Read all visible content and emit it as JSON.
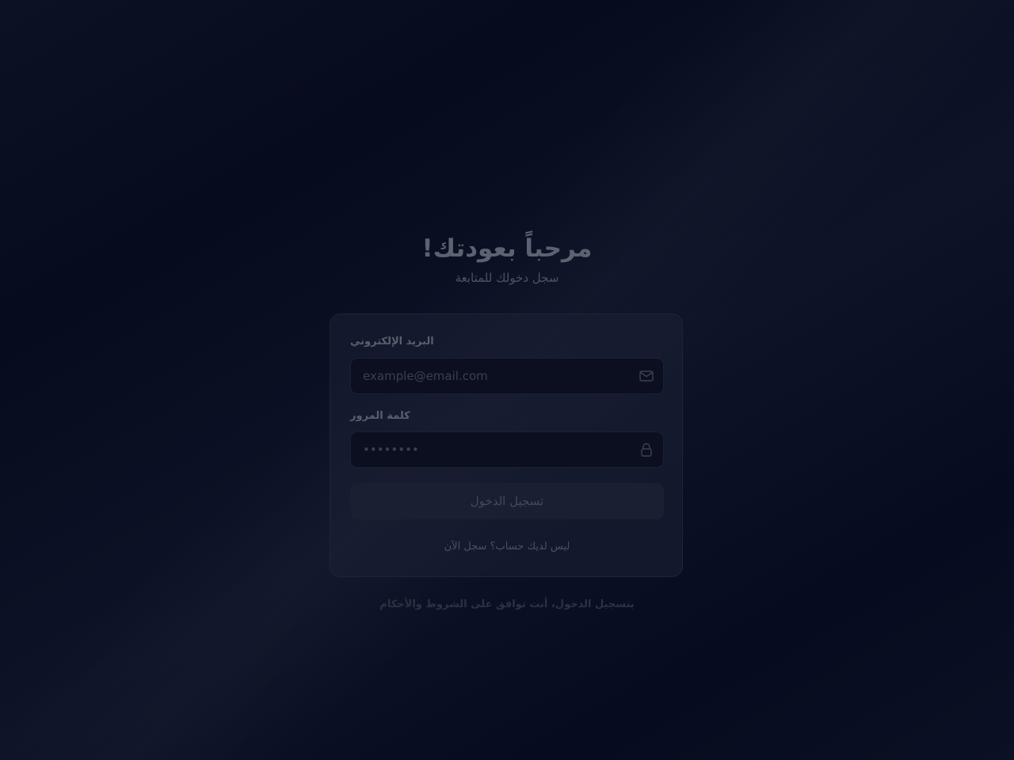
{
  "header": {
    "title": "مرحباً بعودتك!",
    "subtitle": "سجل دخولك للمتابعة"
  },
  "form": {
    "email": {
      "label": "البريد الإلكتروني",
      "placeholder": "example@email.com",
      "icon": "mail-icon"
    },
    "password": {
      "label": "كلمة المرور",
      "placeholder": "••••••••",
      "icon": "lock-icon"
    },
    "submit_label": "تسجيل الدخول",
    "signup_prompt": "ليس لديك حساب؟ سجل الآن"
  },
  "footer": {
    "terms": "بتسجيل الدخول، أنت توافق على الشروط والأحكام"
  }
}
